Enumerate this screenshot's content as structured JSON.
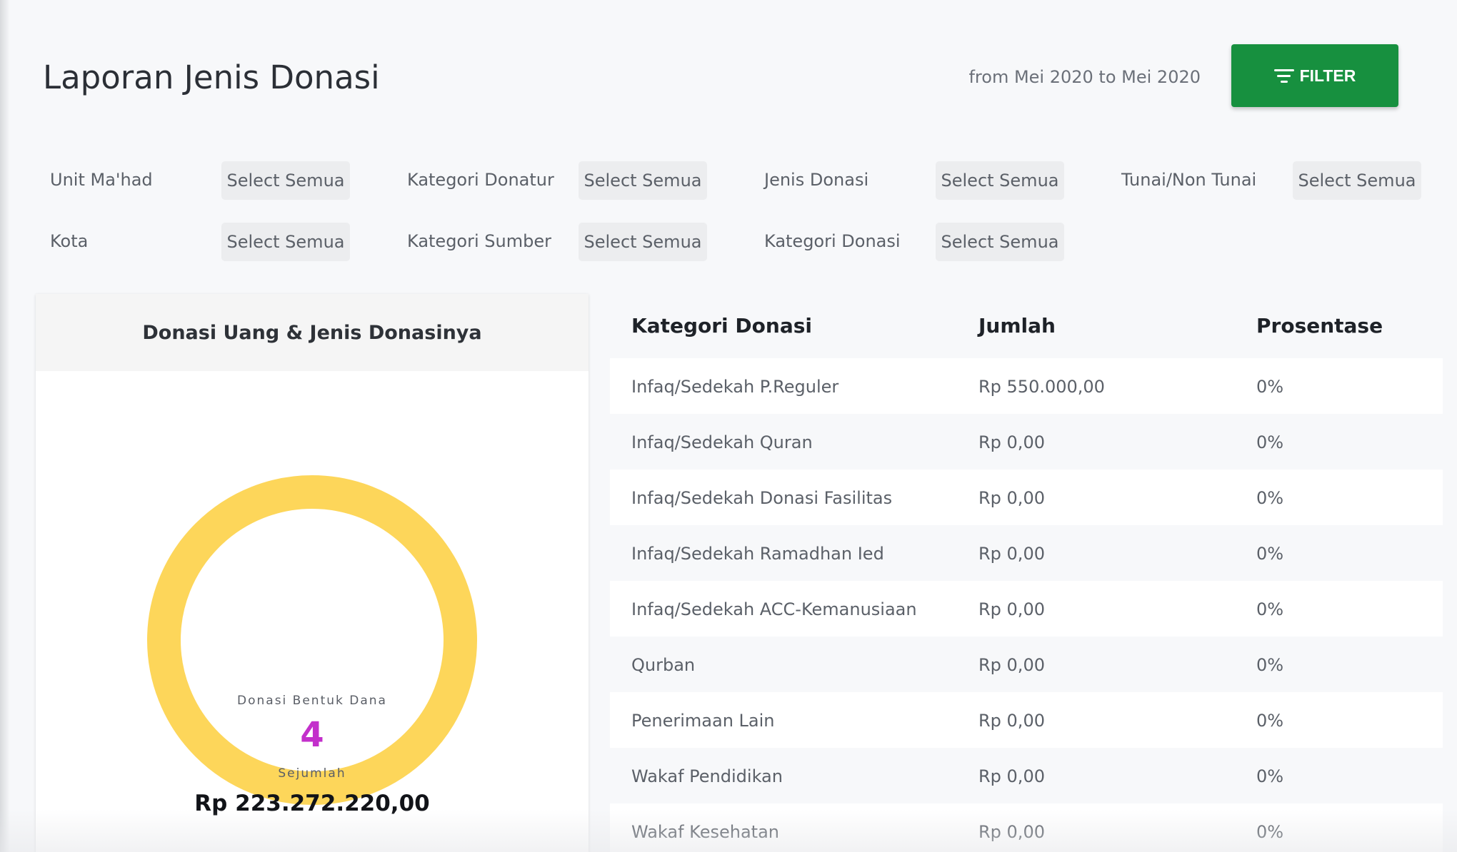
{
  "header": {
    "title": "Laporan Jenis Donasi",
    "date_range": "from Mei 2020 to Mei 2020",
    "filter_label": "FILTER"
  },
  "filters": {
    "unit_mahad": {
      "label": "Unit Ma'had",
      "value": "Select Semua"
    },
    "kategori_donatur": {
      "label": "Kategori Donatur",
      "value": "Select Semua"
    },
    "jenis_donasi": {
      "label": "Jenis Donasi",
      "value": "Select Semua"
    },
    "tunai_non_tunai": {
      "label": "Tunai/Non Tunai",
      "value": "Select Semua"
    },
    "kota": {
      "label": "Kota",
      "value": "Select Semua"
    },
    "kategori_sumber": {
      "label": "Kategori Sumber",
      "value": "Select Semua"
    },
    "kategori_donasi": {
      "label": "Kategori Donasi",
      "value": "Select Semua"
    }
  },
  "donut_card": {
    "title": "Donasi Uang & Jenis Donasinya",
    "caption": "Donasi Bentuk Dana",
    "count": "4",
    "sub_caption": "Sejumlah",
    "total": "Rp 223.272.220,00",
    "ring_color": "#fdd65a",
    "count_color": "#c32fcb"
  },
  "table": {
    "headers": [
      "Kategori Donasi",
      "Jumlah",
      "Prosentase"
    ],
    "rows": [
      [
        "Infaq/Sedekah P.Reguler",
        "Rp 550.000,00",
        "0%"
      ],
      [
        "Infaq/Sedekah Quran",
        "Rp 0,00",
        "0%"
      ],
      [
        "Infaq/Sedekah Donasi Fasilitas",
        "Rp 0,00",
        "0%"
      ],
      [
        "Infaq/Sedekah Ramadhan Ied",
        "Rp 0,00",
        "0%"
      ],
      [
        "Infaq/Sedekah ACC-Kemanusiaan",
        "Rp 0,00",
        "0%"
      ],
      [
        "Qurban",
        "Rp 0,00",
        "0%"
      ],
      [
        "Penerimaan Lain",
        "Rp 0,00",
        "0%"
      ],
      [
        "Wakaf Pendidikan",
        "Rp 0,00",
        "0%"
      ],
      [
        "Wakaf Kesehatan",
        "Rp 0,00",
        "0%"
      ]
    ]
  },
  "colors": {
    "accent": "#17903f",
    "background": "#f7f8fa"
  }
}
